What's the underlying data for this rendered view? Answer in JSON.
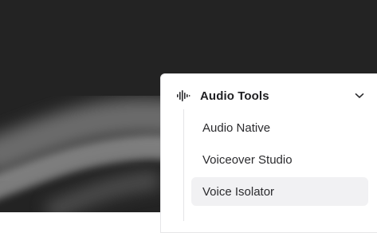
{
  "menu": {
    "group": {
      "label": "Audio Tools",
      "icon": "audio-waveform-icon",
      "expand_icon": "chevron-down-icon"
    },
    "items": [
      {
        "label": "Audio Native",
        "active": false
      },
      {
        "label": "Voiceover Studio",
        "active": false
      },
      {
        "label": "Voice Isolator",
        "active": true
      }
    ]
  },
  "colors": {
    "background": "#232323",
    "panel": "#ffffff",
    "active_item": "#f1f1f3",
    "text": "#1f1f22"
  }
}
